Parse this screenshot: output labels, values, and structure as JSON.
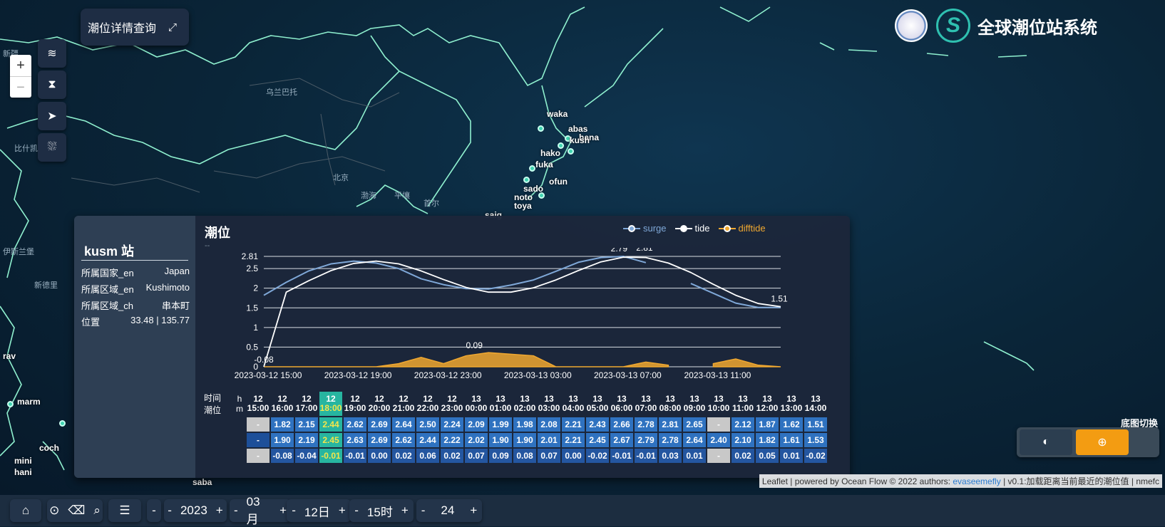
{
  "app": {
    "title": "全球潮位站系统",
    "query_button": "潮位详情查询"
  },
  "map_labels": [
    {
      "text": "乌兰巴托"
    },
    {
      "text": "北京"
    },
    {
      "text": "渤海"
    },
    {
      "text": "平壤"
    },
    {
      "text": "首尔"
    },
    {
      "text": "比什凯"
    },
    {
      "text": "伊斯兰堡"
    },
    {
      "text": "新德里"
    },
    {
      "text": "新疆"
    }
  ],
  "stations": [
    {
      "name": "waka"
    },
    {
      "name": "abas"
    },
    {
      "name": "hana"
    },
    {
      "name": "kush"
    },
    {
      "name": "hako"
    },
    {
      "name": "fuka"
    },
    {
      "name": "ofun"
    },
    {
      "name": "sado"
    },
    {
      "name": "noto"
    },
    {
      "name": "toya"
    },
    {
      "name": "saig"
    },
    {
      "name": "rav"
    },
    {
      "name": "marm"
    },
    {
      "name": "coch"
    },
    {
      "name": "mini"
    },
    {
      "name": "hani"
    },
    {
      "name": "saba"
    }
  ],
  "station_panel": {
    "title": "kusm 站",
    "rows": [
      {
        "label": "所属国家_en",
        "value": "Japan"
      },
      {
        "label": "所属区域_en",
        "value": "Kushimoto"
      },
      {
        "label": "所属区域_ch",
        "value": "串本町"
      },
      {
        "label": "位置",
        "value": "33.48 | 135.77"
      }
    ]
  },
  "chart_data": {
    "type": "line",
    "title": "潮位",
    "subtitle": "--",
    "x": [
      "12 15:00",
      "12 16:00",
      "12 17:00",
      "12 18:00",
      "12 19:00",
      "12 20:00",
      "12 21:00",
      "12 22:00",
      "12 23:00",
      "13 00:00",
      "13 01:00",
      "13 02:00",
      "13 03:00",
      "13 04:00",
      "13 05:00",
      "13 06:00",
      "13 07:00",
      "13 08:00",
      "13 09:00",
      "13 10:00",
      "13 11:00",
      "13 12:00",
      "13 13:00",
      "13 14:00"
    ],
    "x_tick_labels": [
      "2023-03-12 15:00",
      "2023-03-12 19:00",
      "2023-03-12 23:00",
      "2023-03-13 03:00",
      "2023-03-13 07:00",
      "2023-03-13 11:00"
    ],
    "y_tick_labels": [
      "0",
      "0.5",
      "1",
      "1.5",
      "2",
      "2.5",
      "2.81"
    ],
    "ylim": [
      0,
      2.81
    ],
    "series": [
      {
        "name": "surge",
        "color": "#7fa8d8",
        "values": [
          1.82,
          2.15,
          2.44,
          2.62,
          2.69,
          2.64,
          2.5,
          2.24,
          2.09,
          1.99,
          1.98,
          2.08,
          2.21,
          2.43,
          2.66,
          2.78,
          2.81,
          2.65,
          null,
          2.12,
          1.87,
          1.62,
          1.51,
          1.51
        ]
      },
      {
        "name": "tide",
        "color": "#ffffff",
        "values": [
          0,
          1.9,
          2.19,
          2.45,
          2.63,
          2.69,
          2.62,
          2.44,
          2.22,
          2.02,
          1.9,
          1.9,
          2.01,
          2.21,
          2.45,
          2.67,
          2.79,
          2.78,
          2.64,
          2.4,
          2.1,
          1.82,
          1.61,
          1.53
        ]
      },
      {
        "name": "difftide",
        "color": "#f0a830",
        "values": [
          -0.08,
          -0.08,
          -0.04,
          -0.01,
          -0.01,
          0.0,
          0.02,
          0.06,
          0.02,
          0.07,
          0.09,
          0.08,
          0.07,
          0.0,
          -0.02,
          -0.01,
          -0.01,
          0.03,
          0.01,
          null,
          0.02,
          0.05,
          0.01,
          -0.02
        ]
      }
    ],
    "data_labels": [
      {
        "text": "2.81"
      },
      {
        "text": "2.79"
      },
      {
        "text": "1.51"
      },
      {
        "text": "-0.08"
      },
      {
        "text": "0.09"
      }
    ]
  },
  "table": {
    "time_label": "时间",
    "level_label": "潮位",
    "h_label": "h",
    "m_label": "m",
    "headers": [
      {
        "d": "12",
        "t": "15:00"
      },
      {
        "d": "12",
        "t": "16:00"
      },
      {
        "d": "12",
        "t": "17:00"
      },
      {
        "d": "12",
        "t": "18:00"
      },
      {
        "d": "12",
        "t": "19:00"
      },
      {
        "d": "12",
        "t": "20:00"
      },
      {
        "d": "12",
        "t": "21:00"
      },
      {
        "d": "12",
        "t": "22:00"
      },
      {
        "d": "12",
        "t": "23:00"
      },
      {
        "d": "13",
        "t": "00:00"
      },
      {
        "d": "13",
        "t": "01:00"
      },
      {
        "d": "13",
        "t": "02:00"
      },
      {
        "d": "13",
        "t": "03:00"
      },
      {
        "d": "13",
        "t": "04:00"
      },
      {
        "d": "13",
        "t": "05:00"
      },
      {
        "d": "13",
        "t": "06:00"
      },
      {
        "d": "13",
        "t": "07:00"
      },
      {
        "d": "13",
        "t": "08:00"
      },
      {
        "d": "13",
        "t": "09:00"
      },
      {
        "d": "13",
        "t": "10:00"
      },
      {
        "d": "13",
        "t": "11:00"
      },
      {
        "d": "13",
        "t": "12:00"
      },
      {
        "d": "13",
        "t": "13:00"
      },
      {
        "d": "13",
        "t": "14:00"
      }
    ],
    "highlight_index": 3,
    "rows": [
      [
        "-",
        "1.82",
        "2.15",
        "2.44",
        "2.62",
        "2.69",
        "2.64",
        "2.50",
        "2.24",
        "2.09",
        "1.99",
        "1.98",
        "2.08",
        "2.21",
        "2.43",
        "2.66",
        "2.78",
        "2.81",
        "2.65",
        "-",
        "2.12",
        "1.87",
        "1.62",
        "1.51"
      ],
      [
        "-",
        "1.90",
        "2.19",
        "2.45",
        "2.63",
        "2.69",
        "2.62",
        "2.44",
        "2.22",
        "2.02",
        "1.90",
        "1.90",
        "2.01",
        "2.21",
        "2.45",
        "2.67",
        "2.79",
        "2.78",
        "2.64",
        "2.40",
        "2.10",
        "1.82",
        "1.61",
        "1.53"
      ],
      [
        "-",
        "-0.08",
        "-0.04",
        "-0.01",
        "-0.01",
        "0.00",
        "0.02",
        "0.06",
        "0.02",
        "0.07",
        "0.09",
        "0.08",
        "0.07",
        "0.00",
        "-0.02",
        "-0.01",
        "-0.01",
        "0.03",
        "0.01",
        "-",
        "0.02",
        "0.05",
        "0.01",
        "-0.02"
      ]
    ]
  },
  "basemap": {
    "label": "底图切换"
  },
  "attribution": {
    "prefix": "Leaflet | powered by Ocean Flow © 2022 authors: ",
    "link": "evaseemefly",
    "suffix": " | v0.1:加载距离当前最近的潮位值 | nmefc"
  },
  "bottom_bar": {
    "year": "2023",
    "month": "03月",
    "day": "12日",
    "hour": "15时",
    "span": "24",
    "minus": "-",
    "plus": "+"
  },
  "colors": {
    "accent": "#f39c12",
    "teal": "#27b5a0",
    "coast": "#7fe8c8",
    "panel": "#1c273a"
  }
}
